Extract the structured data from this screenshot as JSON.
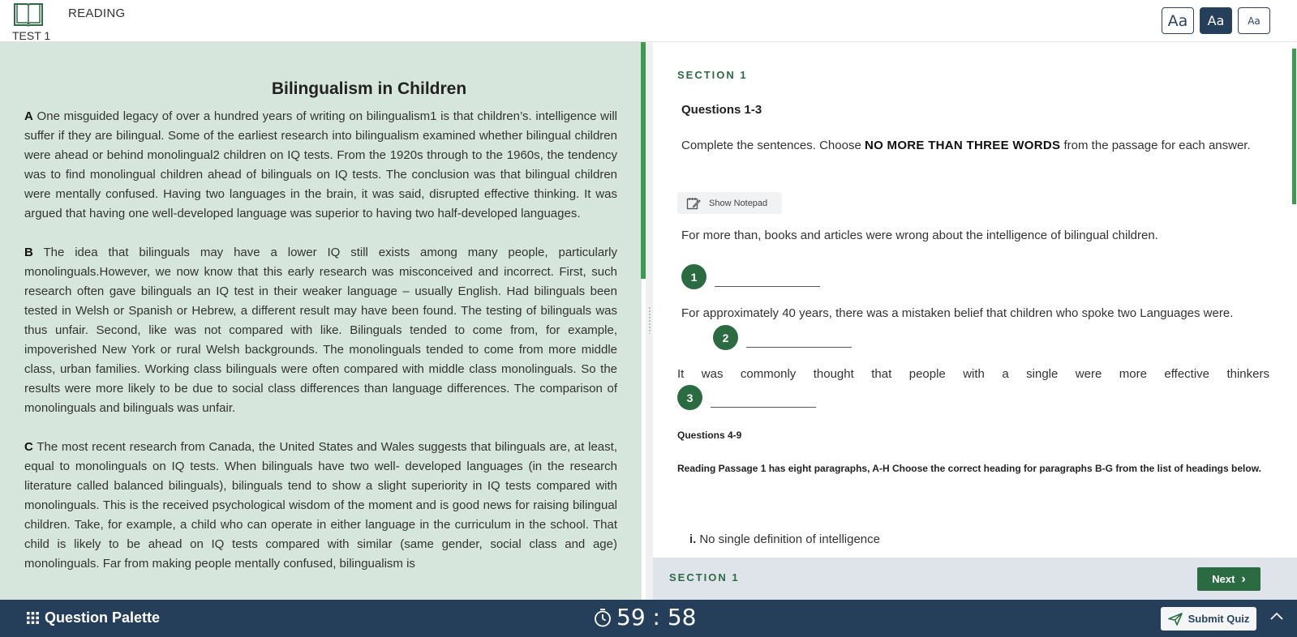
{
  "header": {
    "section_title": "READING",
    "test_label": "TEST 1",
    "font_sizes": [
      {
        "label": "Aa",
        "size": "large"
      },
      {
        "label": "Aa",
        "size": "medium",
        "active": true
      },
      {
        "label": "Aa",
        "size": "small"
      }
    ]
  },
  "passage": {
    "title": "Bilingualism in Children",
    "paragraphs": [
      {
        "letter": "A",
        "text": " One misguided legacy of over a hundred years of writing on bilingualism1 is that children’s. intelligence will suffer if they are bilingual. Some of the earliest research into bilingualism examined whether bilingual children were ahead or behind monolingual2 children on IQ tests. From the 1920s through to the 1960s, the tendency was to find monolingual children ahead of bilinguals on IQ tests. The conclusion was that bilingual children were mentally confused. Having two languages in the brain, it was said, disrupted effective thinking. It was argued that having one well-developed language was superior to having two half-developed languages."
      },
      {
        "letter": "B",
        "text": " The idea that bilinguals may have a lower IQ still exists among many people, particularly monolinguals.However, we now know that this early research was misconceived and incorrect. First, such research often gave bilinguals an IQ test in their weaker language – usually English. Had bilinguals been tested in Welsh or Spanish or Hebrew, a different result may have been found. The testing of bilinguals was thus unfair. Second, like was not compared with like. Bilinguals tended to come from, for example, impoverished New York or rural Welsh backgrounds. The monolinguals tended to come from more middle class, urban families. Working class bilinguals were often compared with middle class monolinguals. So the results were more likely to be due to social class differences than language differences. The comparison of monolinguals and bilinguals was unfair."
      },
      {
        "letter": "C",
        "text": " The most recent research from Canada, the United States and Wales suggests that bilinguals are, at least, equal to monolinguals on IQ tests. When bilinguals have two well- developed languages (in the research literature called balanced bilinguals), bilinguals tend to show a slight superiority in IQ tests compared with monolinguals. This is the received psychological wisdom of the moment and is good news for raising bilingual children. Take, for example, a child who can operate in either language in the curriculum in the school. That child is likely to be ahead on IQ tests compared with similar (same gender, social class and age) monolinguals. Far from making people mentally confused, bilingualism is"
      }
    ]
  },
  "questions": {
    "section_label": "SECTION 1",
    "group1_heading": "Questions 1-3",
    "instruction_pre": "Complete the sentences. Choose ",
    "instruction_bold": "NO MORE THAN THREE WORDS",
    "instruction_post": " from the passage for each answer.",
    "notepad_label": "Show Notepad",
    "q1_text": "For more than, books and articles were wrong about the intelligence of bilingual children.",
    "q1_number": "1",
    "q2_text": "For approximately 40 years, there was a mistaken belief that children who spoke two Languages were.",
    "q2_number": "2",
    "q3_text": "It was commonly thought that people with a single were more effective thinkers",
    "q3_number": "3",
    "group2_heading": "Questions 4-9",
    "group2_instruction": "Reading Passage 1 has eight paragraphs, A-H Choose the correct heading for paragraphs B-G from the list of headings below.",
    "heading_i_marker": "i.",
    "heading_i_text": "No single definition of intelligence"
  },
  "footer": {
    "section_label": "SECTION 1",
    "next_label": "Next"
  },
  "bottombar": {
    "palette_label": "Question Palette",
    "timer": "59 : 58",
    "submit_label": "Submit Quiz"
  },
  "colors": {
    "primary_navy": "#253f5b",
    "accent_green": "#2b6b42",
    "passage_bg": "#d6e6dc"
  }
}
